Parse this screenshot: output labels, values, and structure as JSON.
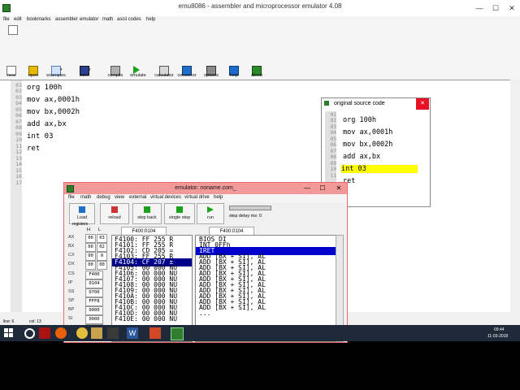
{
  "app": {
    "title": "emu8086 - assembler and microprocessor emulator 4.08",
    "window_controls": [
      "—",
      "☐",
      "✕"
    ]
  },
  "menu": [
    "file",
    "edit",
    "bookmarks",
    "assembler",
    "emulator",
    "math",
    "ascii codes",
    "help"
  ],
  "toolbar": [
    "new",
    "open",
    "examples",
    "save",
    "compile",
    "emulate",
    "calculator",
    "convertor",
    "options",
    "help",
    "about"
  ],
  "editor": {
    "line_numbers": [
      "01",
      "02",
      "03",
      "04",
      "05",
      "06",
      "07",
      "08",
      "09",
      "10",
      "11",
      "12",
      "13",
      "14",
      "15",
      "16",
      "17"
    ],
    "lines": [
      "org 100h",
      "",
      "mov ax,0001h",
      "",
      "mov bx,0002h",
      "",
      "add ax,bx",
      "",
      "int 03",
      "",
      "ret",
      "",
      "",
      "",
      "",
      "",
      ""
    ]
  },
  "status": {
    "line": "line: 6",
    "col": "col: 13"
  },
  "source_window": {
    "title": "original source code",
    "line_numbers": [
      "01",
      "02",
      "03",
      "04",
      "05",
      "06",
      "07",
      "08",
      "09",
      "10",
      "11"
    ],
    "lines": [
      "org 100h",
      "",
      "mov ax,0001h",
      "",
      "mov bx,0002h",
      "",
      "add ax,bx",
      "",
      "int 03",
      "",
      "ret"
    ],
    "highlight_line_index": 8
  },
  "emulator": {
    "title": "emulator: noname.com_",
    "menu": [
      "file",
      "math",
      "debug",
      "view",
      "external",
      "virtual devices",
      "virtual drive",
      "help"
    ],
    "buttons": [
      "Load",
      "reload",
      "step back",
      "single step",
      "run"
    ],
    "step_delay_label": "step delay ms: 0",
    "registers_label": "registers",
    "hl": [
      "H",
      "L"
    ],
    "addr_left": "F400:0104",
    "addr_right": "F400:0104",
    "registers": [
      {
        "name": "AX",
        "h": "00",
        "l": "03"
      },
      {
        "name": "BX",
        "h": "00",
        "l": "02"
      },
      {
        "name": "CX",
        "h": "00",
        "l": "0"
      },
      {
        "name": "DX",
        "h": "00",
        "l": "00"
      },
      {
        "name": "CS",
        "v": "F400"
      },
      {
        "name": "IP",
        "v": "0104"
      },
      {
        "name": "SS",
        "v": "0700"
      },
      {
        "name": "SP",
        "v": "FFF8"
      },
      {
        "name": "BP",
        "v": "0000"
      },
      {
        "name": "SI",
        "v": "0000"
      },
      {
        "name": "DI",
        "v": "0000"
      }
    ],
    "memory_rows": [
      "F4100: FF 255 R",
      "F4101: FF 255 R",
      "F4102: CD 205 =",
      "F4103: FF 255 R",
      "F4104: CF 207 ±",
      "F4105: 00 000 NU",
      "F4106: 00 000 NU",
      "F4107: 00 000 NU",
      "F4108: 00 000 NU",
      "F4109: 00 000 NU",
      "F410A: 00 000 NU",
      "F410B: 00 000 NU",
      "F410C: 00 000 NU",
      "F410D: 00 000 NU",
      "F410E: 00 000 NU"
    ],
    "memory_selected_index": 4,
    "disasm_rows": [
      "BIOS DI",
      "INT 0FFh",
      "IRET",
      "ADD [BX + SI], AL",
      "ADD [BX + SI], AL",
      "ADD [BX + SI], AL",
      "ADD [BX + SI], AL",
      "ADD [BX + SI], AL",
      "ADD [BX + SI], AL",
      "ADD [BX + SI], AL",
      "ADD [BX + SI], AL",
      "ADD [BX + SI], AL",
      "ADD [BX + SI], AL",
      "..."
    ],
    "disasm_selected_index": 2
  },
  "taskbar": {
    "time": "09:44",
    "date": "11-03-2018"
  }
}
